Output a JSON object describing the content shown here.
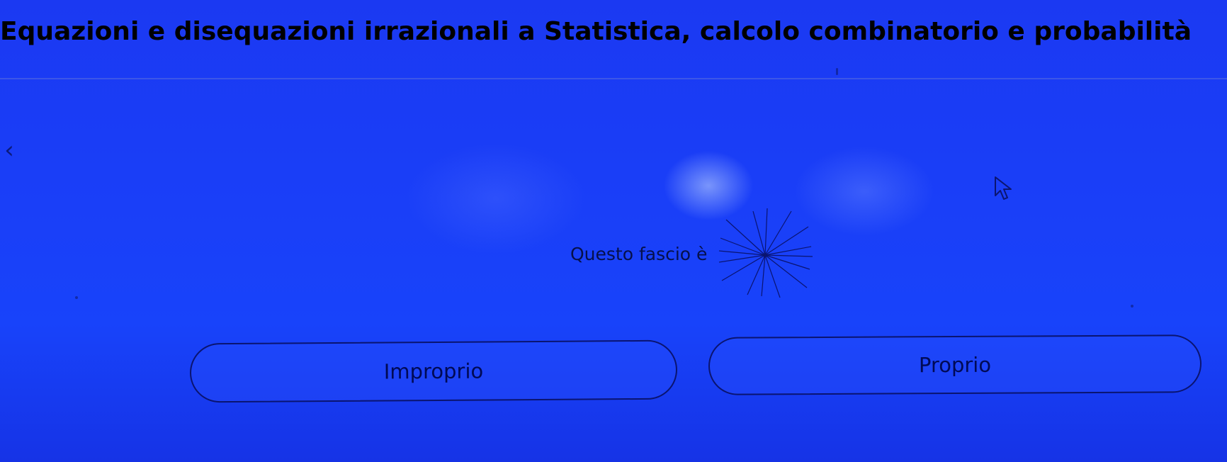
{
  "header": {
    "title": "Equazioni e disequazioni irrazionali a Statistica, calcolo combinatorio e probabilità"
  },
  "navigation": {
    "back_icon": "chevron-left-icon"
  },
  "question": {
    "prompt": "Questo fascio è",
    "figure_icon": "pencil-of-lines-icon"
  },
  "answers": {
    "left_label": "Improprio",
    "right_label": "Proprio"
  },
  "pointer": {
    "icon": "mouse-pointer-icon"
  },
  "colors": {
    "background": "#1a3ff8",
    "text": "#000000",
    "accent": "#0a1470"
  }
}
